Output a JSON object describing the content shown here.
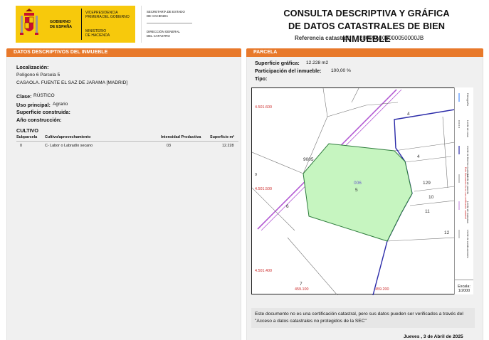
{
  "header": {
    "logo_gov": "GOBIERNO\nDE ESPAÑA",
    "vice": "VICEPRESIDENCIA\nPRIMERA DEL GOBIERNO",
    "ministry": "MINISTERIO\nDE HACIENDA",
    "secretaria": "SECRETARÍA DE ESTADO\nDE HACIENDA",
    "direccion": "DIRECCIÓN GENERAL\nDEL CATASTRO",
    "title": "CONSULTA DESCRIPTIVA Y GRÁFICA\nDE DATOS CATASTRALES DE BIEN INMUEBLE",
    "ref_label": "Referencia catastral:",
    "ref_value": "28059A006000050000JB"
  },
  "left": {
    "bar": "DATOS DESCRIPTIVOS DEL INMUEBLE",
    "localizacion_label": "Localización:",
    "loc_line1": "Polígono 6 Parcela 5",
    "loc_line2": "CASAOLA. FUENTE EL SAZ DE JARAMA [MADRID]",
    "clase_label": "Clase:",
    "clase_value": "RÚSTICO",
    "uso_label": "Uso principal:",
    "uso_value": "Agrario",
    "superficie_label": "Superficie construida:",
    "anio_label": "Año construcción:",
    "cultivo_title": "CULTIVO",
    "cultivo_headers": [
      "Subparcela",
      "Cultivo/aprovechamiento",
      "Intensidad Productiva",
      "Superficie m²"
    ],
    "cultivo_row": [
      "0",
      "C- Labor o Labradío secano",
      "03",
      "12.228"
    ]
  },
  "right": {
    "bar": "PARCELA",
    "sup_label": "Superficie gráfica:",
    "sup_value": "12.228 m2",
    "part_label": "Participación del inmueble:",
    "part_value": "100,00 %",
    "tipo_label": "Tipo:",
    "map": {
      "coord_y1": "4.501.600",
      "coord_y2": "4.501.500",
      "coord_y3": "4.501.400",
      "coord_x1": "459.100",
      "coord_x2": "459.200",
      "parcel_code": "006",
      "parcel_num": "5",
      "labels": [
        "4",
        "4",
        "129",
        "10",
        "11",
        "12",
        "6",
        "7",
        "9005",
        "9"
      ],
      "legend": [
        "Hidrografía",
        "Límite de zona",
        "Límite de término municipal",
        "Límite de parcela",
        "Límite de manzana",
        "Límite de construcciones"
      ],
      "legend_note": "Este documento no es una certificación catastral",
      "scale_label": "Escala:",
      "scale_value": "1/2000"
    },
    "note": "Este documento no es una certificación catastral, pero sus datos pueden ser verificados a través del \"Acceso a datos catastrales no protegidos de la SEC\"",
    "date": "Jueves , 3 de Abril de 2025"
  },
  "colors": {
    "accent": "#e8792b",
    "logo_yellow": "#f7c90c",
    "parcel_fill": "#c6f5c0",
    "parcel_stroke": "#2f7d3d",
    "boundary_blue": "#2a2aa8",
    "road_purple": "#b35ad3"
  }
}
